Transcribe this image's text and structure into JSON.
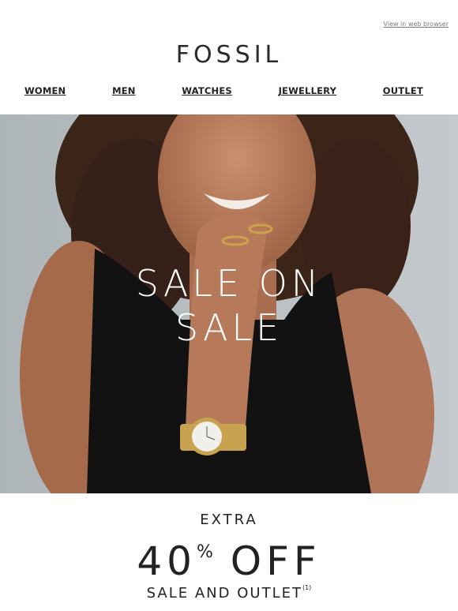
{
  "header": {
    "view_in_browser": "View in web browser",
    "logo_text": "FOSSIL"
  },
  "nav": {
    "items": [
      {
        "label": "WOMEN"
      },
      {
        "label": "MEN"
      },
      {
        "label": "WATCHES"
      },
      {
        "label": "JEWELLERY"
      },
      {
        "label": "OUTLET"
      }
    ]
  },
  "hero": {
    "line1": "SALE ON",
    "line2": "SALE",
    "image_description": "photo"
  },
  "offer": {
    "extra": "EXTRA",
    "percent": "40",
    "percent_sign": "%",
    "off": "OFF",
    "subline": "SALE AND OUTLET",
    "footnote": "(1)"
  },
  "colors": {
    "background": "#ffffff",
    "text": "#222222",
    "hero_bg": "#b9c0c4",
    "hero_text": "#ffffff"
  }
}
